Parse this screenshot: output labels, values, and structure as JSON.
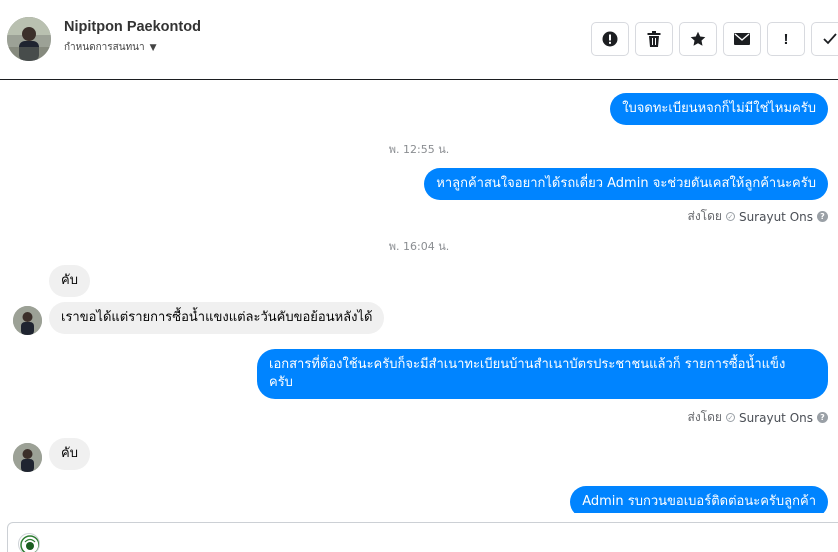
{
  "header": {
    "name": "Nipitpon Paekontod",
    "subline": "กำหนดการสนทนา",
    "toolbar": [
      {
        "name": "report-button",
        "icon": "exclamation-circle-icon"
      },
      {
        "name": "delete-button",
        "icon": "trash-icon"
      },
      {
        "name": "star-button",
        "icon": "star-icon"
      },
      {
        "name": "mark-unread-button",
        "icon": "envelope-icon"
      },
      {
        "name": "important-button",
        "icon": "exclamation-icon"
      },
      {
        "name": "done-button",
        "icon": "check-icon"
      }
    ]
  },
  "thread": {
    "msg1": "ใบจดทะเบียนหจกก็ไม่มีใช่ไหมครับ",
    "time1": "พ. 12:55 น.",
    "msg2": "หาลูกค้าสนใจอยากได้รถเดี่ยว Admin จะช่วยดันเคสให้ลูกค้านะครับ",
    "sent_by_label": "ส่งโดย",
    "sent_by_name": "Surayut Ons",
    "time2": "พ. 16:04 น.",
    "msg3": "คับ",
    "msg4": "เราขอได้แต่รายการซื้อน้ำแขงแต่ละวันคับขอย้อนหลังได้",
    "msg5_line1": "เอกสารที่ต้องใช้นะครับก็จะมีสำเนาทะเบียนบ้านสำเนาบัตรประชาชนแล้วก็ รายการซื้อน้ำแข็ง",
    "msg5_line2": "ครับ",
    "msg6": "คับ",
    "msg7": "Admin รบกวนขอเบอร์ติดต่อนะครับลูกค้า"
  },
  "colors": {
    "outgoing": "#0084ff",
    "incoming": "#f0f0f0",
    "meta": "#8a8d91"
  }
}
